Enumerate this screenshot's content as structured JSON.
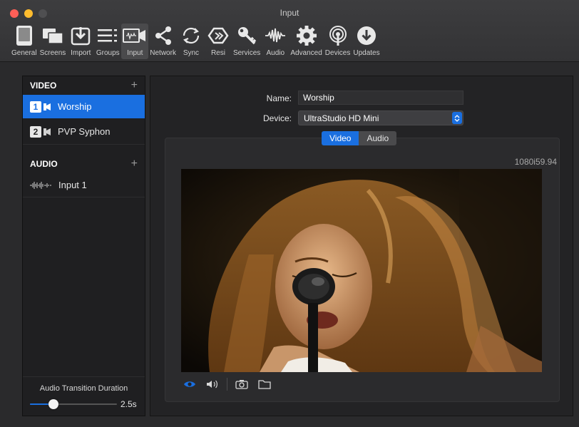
{
  "window": {
    "title": "Input"
  },
  "toolbar": {
    "items": [
      {
        "label": "General",
        "icon": "general-icon"
      },
      {
        "label": "Screens",
        "icon": "screens-icon"
      },
      {
        "label": "Import",
        "icon": "import-icon"
      },
      {
        "label": "Groups",
        "icon": "groups-icon"
      },
      {
        "label": "Input",
        "icon": "input-icon",
        "active": true
      },
      {
        "label": "Network",
        "icon": "network-icon"
      },
      {
        "label": "Sync",
        "icon": "sync-icon"
      },
      {
        "label": "Resi",
        "icon": "resi-icon"
      },
      {
        "label": "Services",
        "icon": "services-icon"
      },
      {
        "label": "Audio",
        "icon": "audio-icon"
      },
      {
        "label": "Advanced",
        "icon": "advanced-icon"
      },
      {
        "label": "Devices",
        "icon": "devices-icon"
      },
      {
        "label": "Updates",
        "icon": "updates-icon"
      }
    ]
  },
  "sidebar": {
    "video": {
      "header": "VIDEO",
      "add": "+",
      "items": [
        {
          "number": "1",
          "label": "Worship",
          "selected": true
        },
        {
          "number": "2",
          "label": "PVP Syphon",
          "selected": false
        }
      ]
    },
    "audio": {
      "header": "AUDIO",
      "add": "+",
      "items": [
        {
          "label": "Input 1"
        }
      ]
    },
    "transition": {
      "label": "Audio Transition Duration",
      "value_text": "2.5s",
      "fraction": 0.27
    }
  },
  "content": {
    "name_label": "Name:",
    "name_value": "Worship",
    "device_label": "Device:",
    "device_value": "UltraStudio HD Mini",
    "tabs": [
      {
        "label": "Video",
        "active": true
      },
      {
        "label": "Audio",
        "active": false
      }
    ],
    "resolution": "1080i59.94"
  },
  "colors": {
    "accent": "#1a6fe0",
    "background": "#2a2a2c"
  }
}
